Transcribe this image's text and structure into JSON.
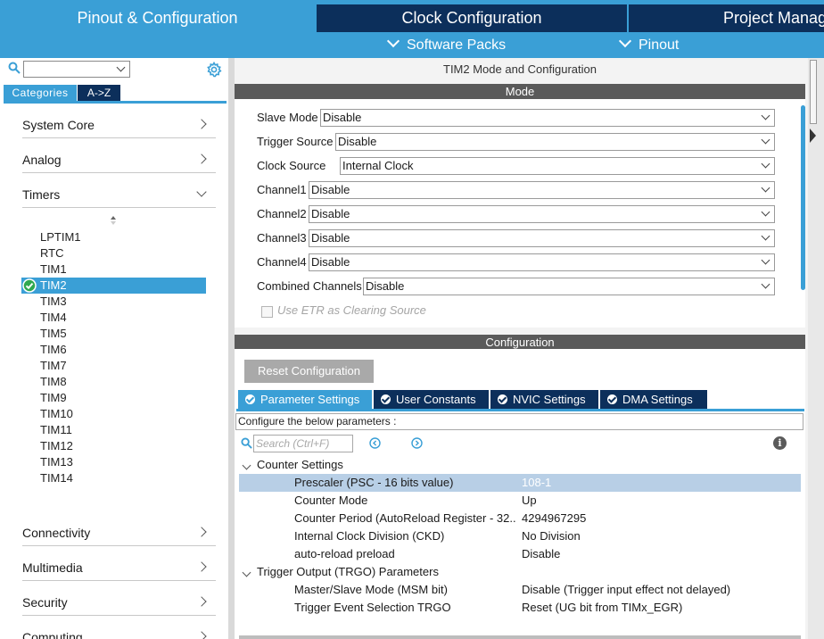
{
  "top_tabs": {
    "pinout": "Pinout & Configuration",
    "clock": "Clock Configuration",
    "project": "Project Manager"
  },
  "sub_tabs": {
    "software_packs": "Software Packs",
    "pinout": "Pinout"
  },
  "left": {
    "search_value": "",
    "tabs": {
      "categories": "Categories",
      "az": "A->Z"
    },
    "categories": [
      "System Core",
      "Analog",
      "Timers",
      "Connectivity",
      "Multimedia",
      "Security",
      "Computing"
    ],
    "timers": [
      "LPTIM1",
      "RTC",
      "TIM1",
      "TIM2",
      "TIM3",
      "TIM4",
      "TIM5",
      "TIM6",
      "TIM7",
      "TIM8",
      "TIM9",
      "TIM10",
      "TIM11",
      "TIM12",
      "TIM13",
      "TIM14"
    ],
    "selected_timer": "TIM2"
  },
  "main": {
    "title": "TIM2 Mode and Configuration",
    "mode_header": "Mode",
    "mode_fields": [
      {
        "label": "Slave Mode",
        "value": "Disable"
      },
      {
        "label": "Trigger Source",
        "value": "Disable"
      },
      {
        "label": "Clock Source",
        "value": "Internal Clock"
      },
      {
        "label": "Channel1",
        "value": "Disable"
      },
      {
        "label": "Channel2",
        "value": "Disable"
      },
      {
        "label": "Channel3",
        "value": "Disable"
      },
      {
        "label": "Channel4",
        "value": "Disable"
      },
      {
        "label": "Combined Channels",
        "value": "Disable"
      }
    ],
    "etr_label": "Use ETR as Clearing Source",
    "etr_checked": false,
    "config_header": "Configuration",
    "reset_label": "Reset Configuration",
    "config_tabs": [
      "Parameter Settings",
      "User Constants",
      "NVIC Settings",
      "DMA Settings"
    ],
    "config_hint": "Configure the below parameters :",
    "search_placeholder": "Search (Ctrl+F)",
    "info_glyph": "i",
    "groups": [
      {
        "name": "Counter Settings",
        "params": [
          {
            "name": "Prescaler (PSC - 16 bits value)",
            "value": "108-1"
          },
          {
            "name": "Counter Mode",
            "value": "Up"
          },
          {
            "name": "Counter Period (AutoReload Register - 32...",
            "value": "4294967295"
          },
          {
            "name": "Internal Clock Division (CKD)",
            "value": "No Division"
          },
          {
            "name": "auto-reload preload",
            "value": "Disable"
          }
        ]
      },
      {
        "name": "Trigger Output (TRGO) Parameters",
        "params": [
          {
            "name": "Master/Slave Mode (MSM bit)",
            "value": "Disable (Trigger input effect not delayed)"
          },
          {
            "name": "Trigger Event Selection TRGO",
            "value": "Reset (UG bit from TIMx_EGR)"
          }
        ]
      }
    ]
  },
  "colors": {
    "accent": "#3a9fd6",
    "navy": "#0c2f5b",
    "header_gray": "#5a5a5a",
    "success_green": "#2fa84f"
  }
}
